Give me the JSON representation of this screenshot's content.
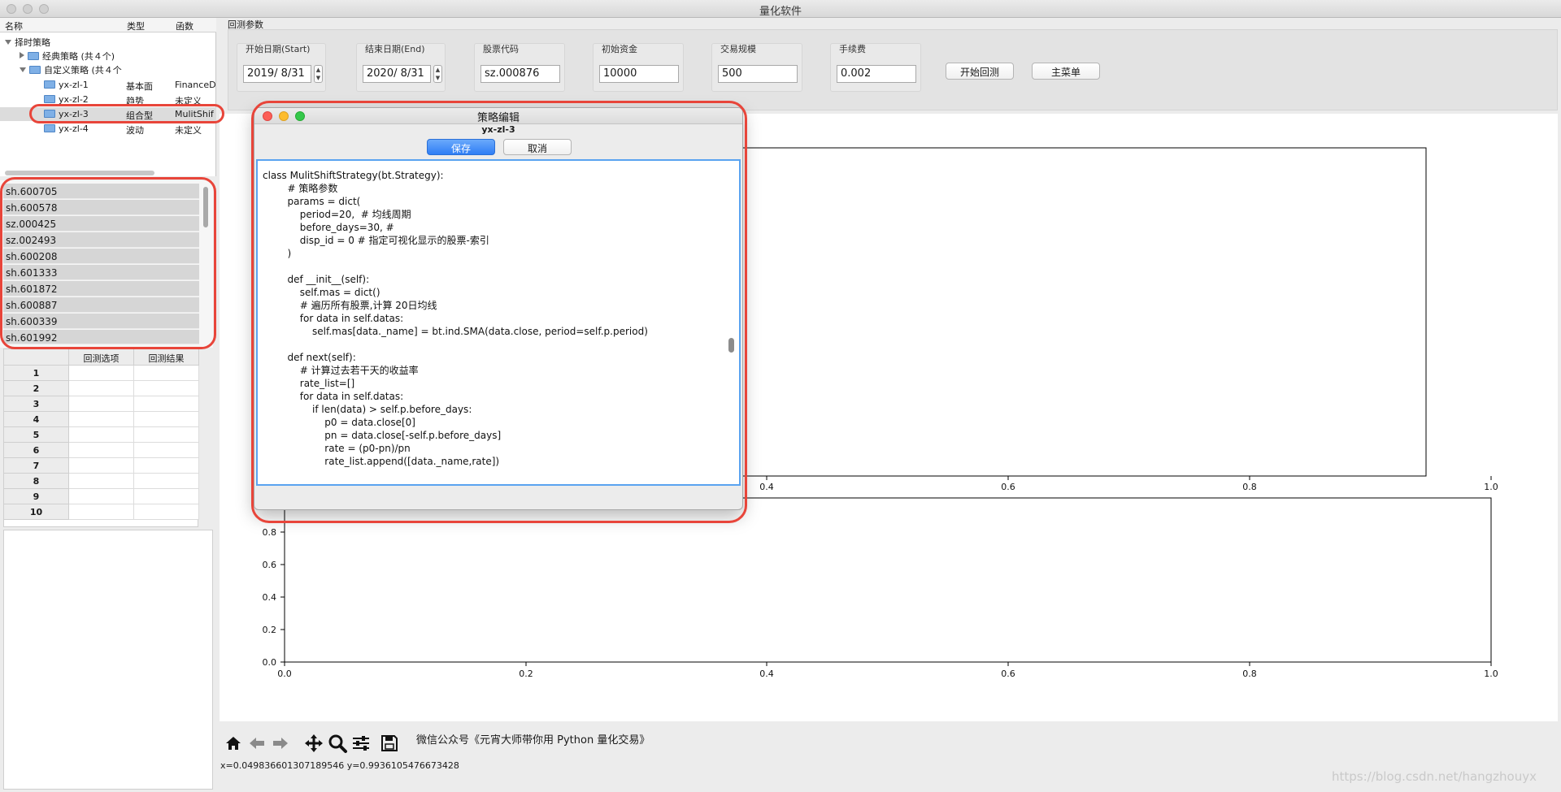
{
  "window": {
    "title": "量化软件"
  },
  "tree": {
    "headers": {
      "name": "名称",
      "type": "类型",
      "func": "函数"
    },
    "root": "择时策略",
    "classic": "经典策略 (共４个)",
    "custom": "自定义策略 (共４个",
    "items": [
      {
        "name": "yx-zl-1",
        "type": "基本面",
        "func": "FinanceD"
      },
      {
        "name": "yx-zl-2",
        "type": "趋势",
        "func": "未定义"
      },
      {
        "name": "yx-zl-3",
        "type": "组合型",
        "func": "MulitShif"
      },
      {
        "name": "yx-zl-4",
        "type": "波动",
        "func": "未定义"
      }
    ]
  },
  "stocks": [
    "sh.600705",
    "sh.600578",
    "sz.000425",
    "sz.002493",
    "sh.600208",
    "sh.601333",
    "sh.601872",
    "sh.600887",
    "sh.600339",
    "sh.601992"
  ],
  "grid": {
    "col1": "回测选项",
    "col2": "回测结果",
    "rows": [
      "1",
      "2",
      "3",
      "4",
      "5",
      "6",
      "7",
      "8",
      "9",
      "10"
    ]
  },
  "params": {
    "section_label": "回测参数",
    "start_label": "开始日期(Start)",
    "start_value": "2019/  8/31",
    "end_label": "结束日期(End)",
    "end_value": "2020/  8/31",
    "code_label": "股票代码",
    "code_value": "sz.000876",
    "capital_label": "初始资金",
    "capital_value": "10000",
    "scale_label": "交易规模",
    "scale_value": "500",
    "fee_label": "手续费",
    "fee_value": "0.002",
    "start_button": "开始回测",
    "menu_button": "主菜单"
  },
  "plot": {
    "top_xticks": [
      "0.4",
      "0.6",
      "0.8",
      "1.0"
    ],
    "bottom_xticks": [
      "0.0",
      "0.2",
      "0.4",
      "0.6",
      "0.8",
      "1.0"
    ],
    "bottom_yticks": [
      "0.0",
      "0.2",
      "0.4",
      "0.6",
      "0.8"
    ]
  },
  "toolbar": {
    "text": "微信公众号《元宵大师带你用 Python 量化交易》",
    "icons": [
      "home-icon",
      "back-icon",
      "forward-icon",
      "pan-icon",
      "zoom-icon",
      "configure-icon",
      "save-icon"
    ]
  },
  "status": {
    "coords": "x=0.049836601307189546  y=0.9936105476673428"
  },
  "watermark": "https://blog.csdn.net/hangzhouyx",
  "dialog": {
    "title": "策略编辑",
    "subtitle": "yx-zl-3",
    "save": "保存",
    "cancel": "取消",
    "code": "class MulitShiftStrategy(bt.Strategy):\n        # 策略参数\n        params = dict(\n            period=20,  # 均线周期\n            before_days=30, #\n            disp_id = 0 # 指定可视化显示的股票-索引\n        )\n\n        def __init__(self):\n            self.mas = dict()\n            # 遍历所有股票,计算 20日均线\n            for data in self.datas:\n                self.mas[data._name] = bt.ind.SMA(data.close, period=self.p.period)\n\n        def next(self):\n            # 计算过去若干天的收益率\n            rate_list=[]\n            for data in self.datas:\n                if len(data) > self.p.before_days:\n                    p0 = data.close[0]\n                    pn = data.close[-self.p.before_days]\n                    rate = (p0-pn)/pn\n                    rate_list.append([data._name,rate])"
  },
  "colors": {
    "accent": "#2f7ef5",
    "highlight_ring": "#e8453a"
  }
}
